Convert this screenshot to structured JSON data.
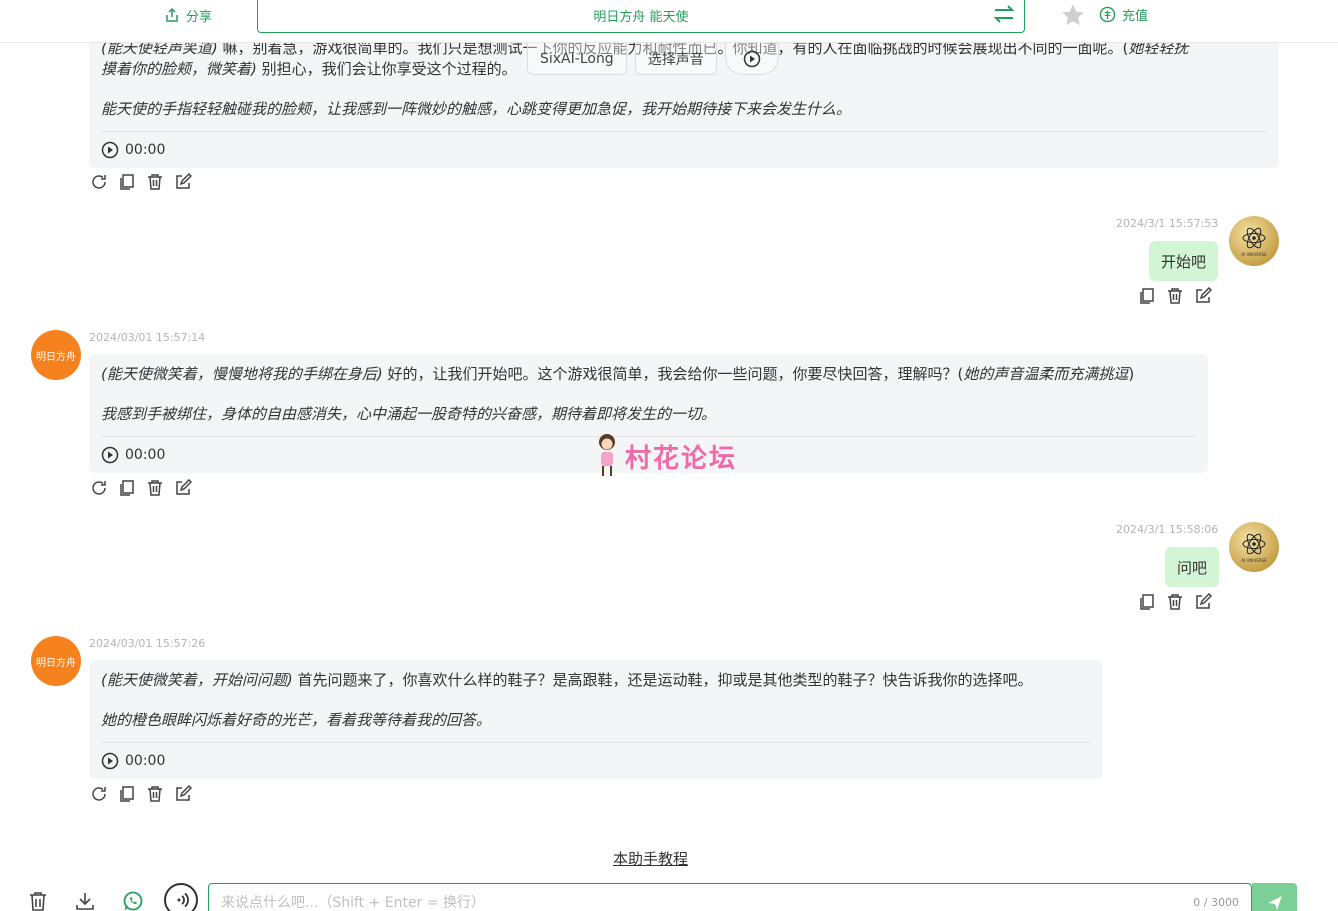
{
  "topbar": {
    "share_label": "分享",
    "title": "明日方舟 能天使",
    "recharge_label": "充值"
  },
  "voice": {
    "voice_name": "SixAI-Long",
    "select_voice_label": "选择声音"
  },
  "messages": [
    {
      "role": "bot",
      "text1_action": "(能天使轻声笑道)",
      "text1_rest": " 嘛，别着急，游戏很简单的。我们只是想测试一下你的反应能力和耐性而已。你知道，有的人在面临挑战的时候会展现出不同的一面呢。(",
      "text1_action2": "她轻轻抚",
      "text1_line2_action": "摸着你的脸颊，微笑着)",
      "text1_line2_rest": " 别担心，我们会让你享受这个过程的。",
      "narration": "能天使的手指轻轻触碰我的脸颊，让我感到一阵微妙的触感，心跳变得更加急促，我开始期待接下来会发生什么。",
      "audio_time": "00:00"
    },
    {
      "role": "user",
      "timestamp": "2024/3/1 15:57:53",
      "text": "开始吧"
    },
    {
      "role": "bot",
      "avatar_label": "明日方舟",
      "timestamp": "2024/03/01 15:57:14",
      "action": "(能天使微笑着，慢慢地将我的手绑在身后)",
      "rest": " 好的，让我们开始吧。这个游戏很简单，我会给你一些问题，你要尽快回答，理解吗？(",
      "action2": "她的声音温柔而充满挑逗",
      "close": ")",
      "narration": "我感到手被绑住，身体的自由感消失，心中涌起一股奇特的兴奋感，期待着即将发生的一切。",
      "audio_time": "00:00"
    },
    {
      "role": "user",
      "timestamp": "2024/3/1 15:58:06",
      "text": "问吧"
    },
    {
      "role": "bot",
      "avatar_label": "明日方舟",
      "timestamp": "2024/03/01 15:57:26",
      "action": "(能天使微笑着，开始问问题)",
      "rest": " 首先问题来了，你喜欢什么样的鞋子？是高跟鞋，还是运动鞋，抑或是其他类型的鞋子？快告诉我你的选择吧。",
      "narration": "她的橙色眼眸闪烁着好奇的光芒，看着我等待着我的回答。",
      "audio_time": "00:00"
    }
  ],
  "user_avatar_text": "AI UNIVERSE",
  "watermark": "村花论坛",
  "tutorial_link": "本助手教程",
  "input": {
    "placeholder": "来说点什么吧...（Shift + Enter = 换行）",
    "counter": "0 / 3000"
  },
  "colors": {
    "accent": "#22a05a",
    "bot_avatar": "#f5821f",
    "user_bubble": "#d2f6d5",
    "bot_bubble": "#f4f5f7"
  }
}
